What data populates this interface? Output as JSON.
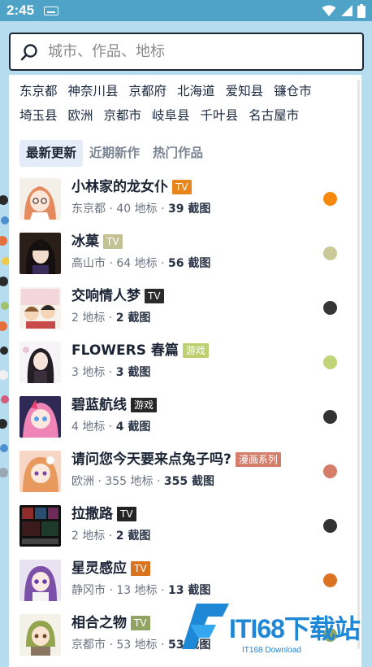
{
  "status_bar": {
    "time": "2:45"
  },
  "search": {
    "placeholder": "城市、作品、地标"
  },
  "locations": [
    "东京都",
    "神奈川县",
    "京都府",
    "北海道",
    "爱知县",
    "镰仓市",
    "埼玉县",
    "欧洲",
    "京都市",
    "岐阜县",
    "千叶县",
    "名古屋市"
  ],
  "tabs": [
    {
      "label": "最新更新",
      "active": true
    },
    {
      "label": "近期新作",
      "active": false
    },
    {
      "label": "热门作品",
      "active": false
    }
  ],
  "items": [
    {
      "title": "小林家的龙女仆",
      "badge": "TV",
      "badge_color": "#e8861c",
      "location": "东京都",
      "landmarks": "40 地标",
      "screenshots": "39 截图",
      "dot_color": "#f5890f",
      "thumb": "dragon-maid"
    },
    {
      "title": "冰菓",
      "badge": "TV",
      "badge_color": "#c2c294",
      "location": "高山市",
      "landmarks": "64 地标",
      "screenshots": "56 截图",
      "dot_color": "#cbc898",
      "thumb": "hyouka"
    },
    {
      "title": "交响情人梦",
      "badge": "TV",
      "badge_color": "#2b2b2b",
      "location": "",
      "landmarks": "2 地标",
      "screenshots": "2 截图",
      "dot_color": "#363636",
      "thumb": "nodame"
    },
    {
      "title": "FLOWERS 春篇",
      "badge": "游戏",
      "badge_color": "#bcd070",
      "location": "",
      "landmarks": "3 地标",
      "screenshots": "3 截图",
      "dot_color": "#c1d47a",
      "thumb": "flowers"
    },
    {
      "title": "碧蓝航线",
      "badge": "游戏",
      "badge_color": "#262626",
      "location": "",
      "landmarks": "4 地标",
      "screenshots": "4 截图",
      "dot_color": "#333333",
      "thumb": "azur-lane"
    },
    {
      "title": "请问您今天要来点兔子吗?",
      "badge": "漫画系列",
      "badge_color": "#d37d6a",
      "location": "欧洲",
      "landmarks": "355 地标",
      "screenshots": "355 截图",
      "dot_color": "#d57d68",
      "thumb": "gochiusa"
    },
    {
      "title": "拉撒路",
      "badge": "TV",
      "badge_color": "#232323",
      "location": "",
      "landmarks": "2 地标",
      "screenshots": "2 截图",
      "dot_color": "#333333",
      "thumb": "lazarus"
    },
    {
      "title": "星灵感应",
      "badge": "TV",
      "badge_color": "#d9731f",
      "location": "静冈市",
      "landmarks": "13 地标",
      "screenshots": "13 截图",
      "dot_color": "#db7322",
      "thumb": "hoshi"
    },
    {
      "title": "相合之物",
      "badge": "TV",
      "badge_color": "#92a464",
      "location": "京都市",
      "landmarks": "53 地标",
      "screenshots": "53 截图",
      "dot_color": "#90a868",
      "thumb": "aiai"
    }
  ],
  "watermark": {
    "text": "ITI68下载站",
    "sub": "IT168 Download"
  }
}
